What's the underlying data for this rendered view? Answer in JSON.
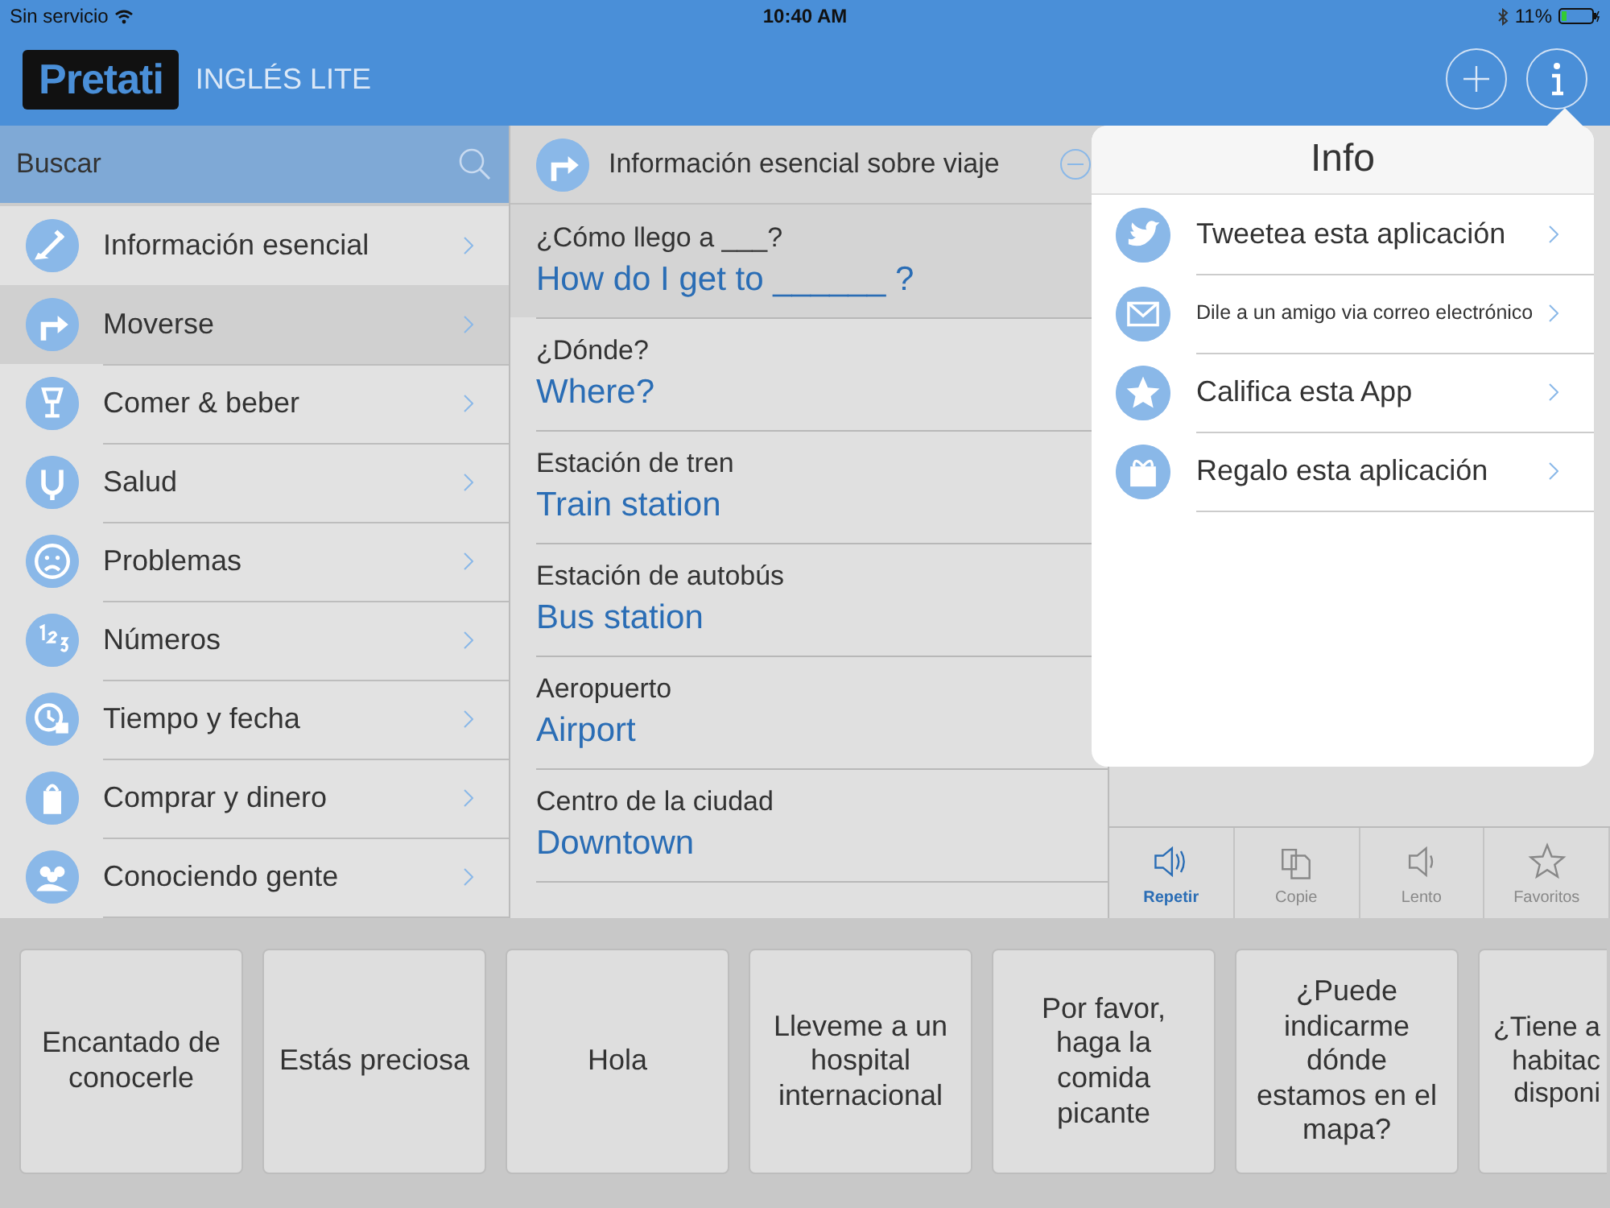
{
  "status_bar": {
    "carrier": "Sin servicio",
    "time": "10:40 AM",
    "battery": "11%"
  },
  "header": {
    "logo": "Pretati",
    "title": "INGLÉS LITE"
  },
  "search": {
    "placeholder": "Buscar"
  },
  "sidebar": {
    "items": [
      {
        "label": "Información esencial",
        "selected": false
      },
      {
        "label": "Moverse",
        "selected": true
      },
      {
        "label": "Comer & beber",
        "selected": false
      },
      {
        "label": "Salud",
        "selected": false
      },
      {
        "label": "Problemas",
        "selected": false
      },
      {
        "label": "Números",
        "selected": false
      },
      {
        "label": "Tiempo y fecha",
        "selected": false
      },
      {
        "label": "Comprar y dinero",
        "selected": false
      },
      {
        "label": "Conociendo gente",
        "selected": false
      }
    ]
  },
  "phrases": {
    "title": "Información esencial sobre viaje",
    "rows": [
      {
        "source": "¿Cómo llego a ___?",
        "target": "How do I get to ______ ?",
        "selected": true
      },
      {
        "source": "¿Dónde?",
        "target": "Where?",
        "selected": false
      },
      {
        "source": "Estación de tren",
        "target": "Train station",
        "selected": false
      },
      {
        "source": "Estación de autobús",
        "target": "Bus station",
        "selected": false
      },
      {
        "source": "Aeropuerto",
        "target": "Airport",
        "selected": false
      },
      {
        "source": "Centro de la ciudad",
        "target": "Downtown",
        "selected": false
      }
    ]
  },
  "toolbar": [
    {
      "label": "Repetir",
      "selected": true
    },
    {
      "label": "Copie",
      "selected": false
    },
    {
      "label": "Lento",
      "selected": false
    },
    {
      "label": "Favoritos",
      "selected": false
    }
  ],
  "info_popover": {
    "title": "Info",
    "items": [
      {
        "label": "Tweetea esta aplicación",
        "kind": "normal"
      },
      {
        "label": "Dile a un amigo via correo electrónico",
        "kind": "small"
      },
      {
        "label": "Califica esta App",
        "kind": "normal"
      },
      {
        "label": "Regalo esta aplicación",
        "kind": "normal"
      }
    ]
  },
  "quick_phrases": [
    "Encantado de\nconocerle",
    "Estás preciosa",
    "Hola",
    "Lleveme a un\nhospital\ninternacional",
    "Por favor,\nhaga la\ncomida\npicante",
    "¿Puede\nindicarme\ndónde\nestamos en el\nmapa?",
    "¿Tiene a\nhabitac\ndisponi"
  ]
}
